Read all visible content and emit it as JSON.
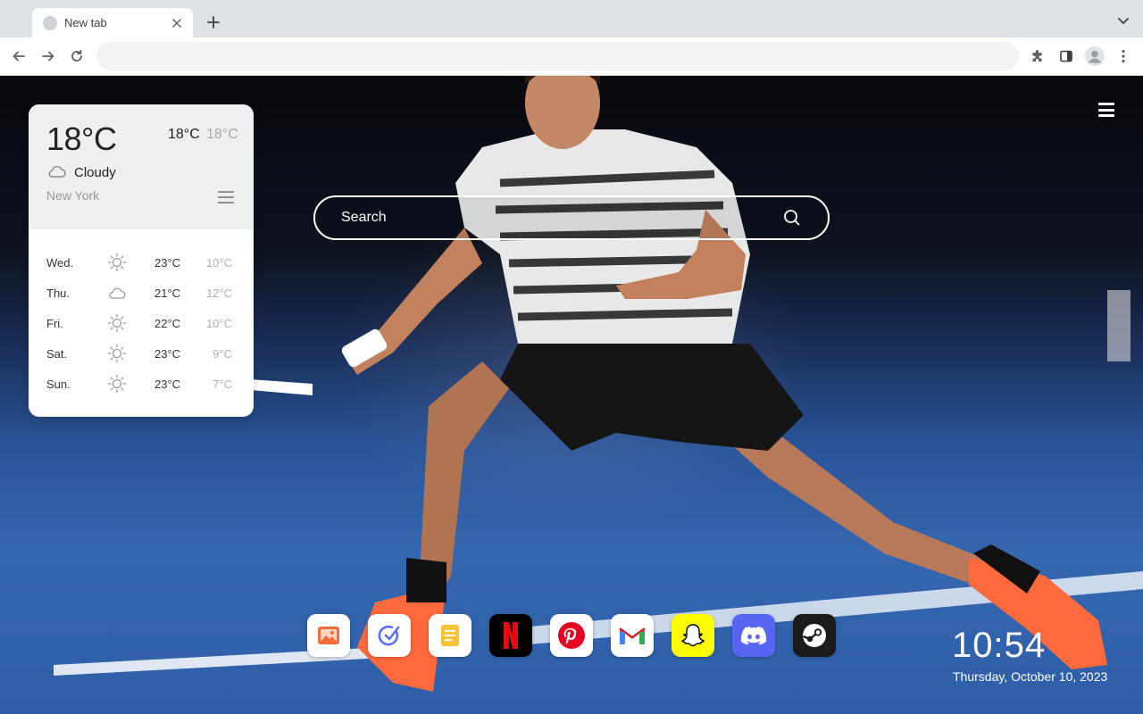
{
  "browser": {
    "tab_title": "New tab",
    "omnibox_value": "",
    "colors": {
      "chrome": "#dee1e6",
      "toolbar": "#ffffff",
      "omnibox": "#f1f3f4"
    }
  },
  "weather": {
    "current_temp": "18°C",
    "high": "18°C",
    "low": "18°C",
    "condition": "Cloudy",
    "condition_icon": "cloud-icon",
    "city": "New York",
    "forecast": [
      {
        "day": "Wed.",
        "icon": "sun-icon",
        "high": "23°C",
        "low": "10°C"
      },
      {
        "day": "Thu.",
        "icon": "cloud-icon",
        "high": "21°C",
        "low": "12°C"
      },
      {
        "day": "Fri.",
        "icon": "sun-icon",
        "high": "22°C",
        "low": "10°C"
      },
      {
        "day": "Sat.",
        "icon": "sun-icon",
        "high": "23°C",
        "low": "9°C"
      },
      {
        "day": "Sun.",
        "icon": "sun-icon",
        "high": "23°C",
        "low": "7°C"
      }
    ]
  },
  "search": {
    "placeholder": "Search"
  },
  "dock": [
    {
      "name": "wallpaper",
      "icon": "image-icon",
      "bg": "#ffffff"
    },
    {
      "name": "tasks",
      "icon": "check-icon",
      "bg": "#ffffff"
    },
    {
      "name": "notes",
      "icon": "note-icon",
      "bg": "#ffffff"
    },
    {
      "name": "netflix",
      "icon": "netflix-icon",
      "bg": "#000000"
    },
    {
      "name": "pinterest",
      "icon": "pinterest-icon",
      "bg": "#ffffff"
    },
    {
      "name": "gmail",
      "icon": "gmail-icon",
      "bg": "#ffffff"
    },
    {
      "name": "snapchat",
      "icon": "snapchat-icon",
      "bg": "#fffc00"
    },
    {
      "name": "discord",
      "icon": "discord-icon",
      "bg": "#5865f2"
    },
    {
      "name": "steam",
      "icon": "steam-icon",
      "bg": "#1b1b1b"
    }
  ],
  "clock": {
    "time": "10:54",
    "date": "Thursday, October 10, 2023"
  }
}
